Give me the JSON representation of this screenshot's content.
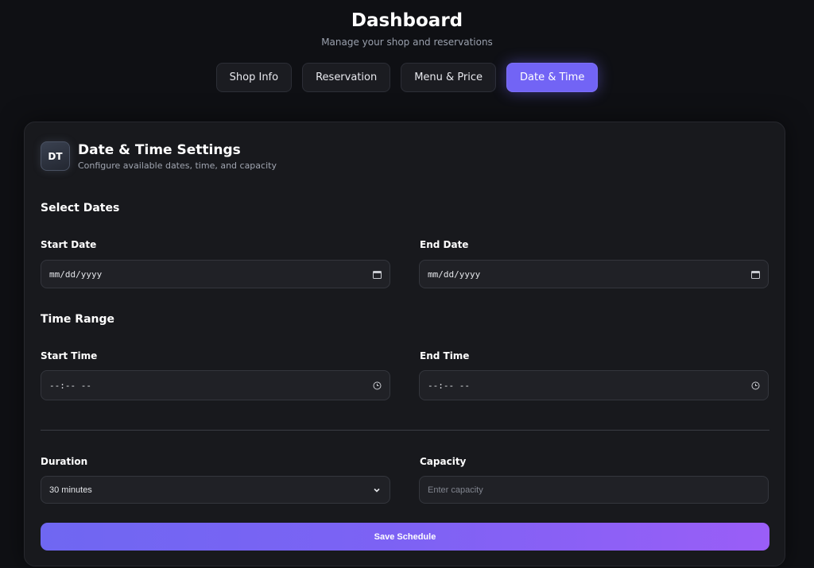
{
  "header": {
    "title": "Dashboard",
    "subtitle": "Manage your shop and reservations"
  },
  "tabs": [
    {
      "label": "Shop Info",
      "active": false
    },
    {
      "label": "Reservation",
      "active": false
    },
    {
      "label": "Menu & Price",
      "active": false
    },
    {
      "label": "Date & Time",
      "active": true
    }
  ],
  "card": {
    "badge": "DT",
    "title": "Date & Time Settings",
    "subtitle": "Configure available dates, time, and capacity"
  },
  "dates": {
    "section_title": "Select Dates",
    "start_label": "Start Date",
    "start_value": "mm/dd/yyyy",
    "end_label": "End Date",
    "end_value": "mm/dd/yyyy"
  },
  "time": {
    "section_title": "Time Range",
    "start_label": "Start Time",
    "start_value": "--:-- --",
    "end_label": "End Time",
    "end_value": "--:-- --"
  },
  "duration": {
    "label": "Duration",
    "selected": "30 minutes"
  },
  "capacity": {
    "label": "Capacity",
    "placeholder": "Enter capacity"
  },
  "save_label": "Save Schedule",
  "colors": {
    "accent": "#7264f5",
    "background": "#0f1014",
    "card": "#18191d"
  }
}
